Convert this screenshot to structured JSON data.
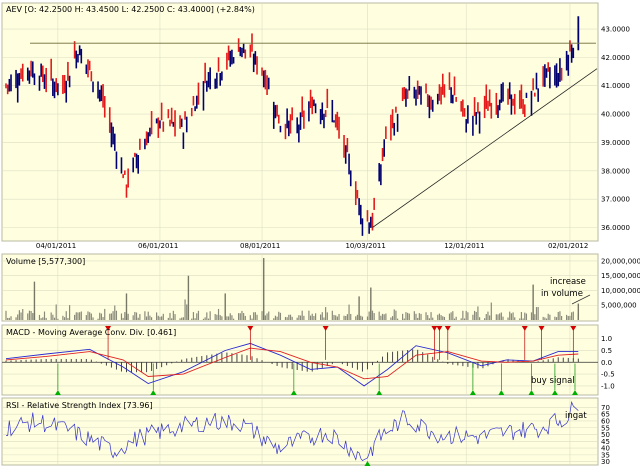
{
  "chart_data": [
    {
      "type": "candlestick",
      "title": "AEV [O: 42.2500  H: 43.4500  L: 42.2500  C: 43.4000]  (+2.84%)",
      "x_tick_labels": [
        "04/01/2011",
        "06/01/2011",
        "08/01/2011",
        "10/03/2011",
        "12/01/2011",
        "02/01/2012"
      ],
      "y_tick_labels": [
        "36.0000",
        "37.0000",
        "38.0000",
        "39.0000",
        "40.0000",
        "41.0000",
        "42.0000",
        "43.0000"
      ],
      "ylim": [
        35.7,
        43.6
      ],
      "resistance_level": 42.5,
      "trendline": {
        "start": {
          "date": "2011-10-06",
          "price": 36.0
        },
        "end": {
          "date": "2012-02-06",
          "price": 41.6
        }
      },
      "last_bar": {
        "open": 42.25,
        "high": 43.45,
        "low": 42.25,
        "close": 43.4
      },
      "series": [
        {
          "date": "2011-03-01",
          "close": 41.0
        },
        {
          "date": "2011-03-15",
          "close": 41.6
        },
        {
          "date": "2011-04-04",
          "close": 40.9
        },
        {
          "date": "2011-04-13",
          "close": 42.3
        },
        {
          "date": "2011-04-25",
          "close": 41.0
        },
        {
          "date": "2011-05-05",
          "close": 39.0
        },
        {
          "date": "2011-05-12",
          "close": 37.5
        },
        {
          "date": "2011-05-20",
          "close": 38.8
        },
        {
          "date": "2011-06-01",
          "close": 39.8
        },
        {
          "date": "2011-06-15",
          "close": 39.5
        },
        {
          "date": "2011-06-28",
          "close": 41.2
        },
        {
          "date": "2011-07-10",
          "close": 41.8
        },
        {
          "date": "2011-07-20",
          "close": 42.4
        },
        {
          "date": "2011-08-01",
          "close": 41.6
        },
        {
          "date": "2011-08-12",
          "close": 39.7
        },
        {
          "date": "2011-08-22",
          "close": 39.5
        },
        {
          "date": "2011-09-01",
          "close": 40.4
        },
        {
          "date": "2011-09-12",
          "close": 40.1
        },
        {
          "date": "2011-09-22",
          "close": 38.2
        },
        {
          "date": "2011-09-30",
          "close": 36.4
        },
        {
          "date": "2011-10-06",
          "close": 36.2
        },
        {
          "date": "2011-10-14",
          "close": 39.2
        },
        {
          "date": "2011-10-28",
          "close": 40.8
        },
        {
          "date": "2011-11-10",
          "close": 40.5
        },
        {
          "date": "2011-11-22",
          "close": 40.9
        },
        {
          "date": "2011-12-01",
          "close": 39.8
        },
        {
          "date": "2011-12-12",
          "close": 40.2
        },
        {
          "date": "2011-12-22",
          "close": 40.6
        },
        {
          "date": "2012-01-05",
          "close": 40.3
        },
        {
          "date": "2012-01-16",
          "close": 41.3
        },
        {
          "date": "2012-01-26",
          "close": 41.4
        },
        {
          "date": "2012-02-02",
          "close": 42.3
        },
        {
          "date": "2012-02-06",
          "close": 43.4
        }
      ]
    },
    {
      "type": "bar",
      "title": "Volume [5,577,300]",
      "y_tick_labels": [
        "5,000,000",
        "10,000,000",
        "15,000,000",
        "20,000,000"
      ],
      "ylim": [
        0,
        21000000
      ],
      "annotation": "increase\nin volume",
      "spikes": [
        {
          "date": "2011-03-18",
          "value": 13000000
        },
        {
          "date": "2011-05-12",
          "value": 9000000
        },
        {
          "date": "2011-06-18",
          "value": 15000000
        },
        {
          "date": "2011-08-02",
          "value": 21000000
        },
        {
          "date": "2011-07-10",
          "value": 9000000
        },
        {
          "date": "2011-09-28",
          "value": 8000000
        },
        {
          "date": "2011-10-05",
          "value": 11000000
        },
        {
          "date": "2012-01-10",
          "value": 12000000
        },
        {
          "date": "2012-02-06",
          "value": 5577300
        }
      ]
    },
    {
      "type": "line",
      "title": "MACD - Moving Average Conv. Div. [0.461]",
      "y_tick_labels": [
        "-1.0",
        "-0.5",
        "0.0",
        "0.5",
        "1.0"
      ],
      "ylim": [
        -1.3,
        1.45
      ],
      "annotation": "buy signal",
      "series": [
        {
          "name": "MACD",
          "color": "#2b2bd0",
          "values": [
            {
              "date": "2011-03-01",
              "value": 0.15
            },
            {
              "date": "2011-03-25",
              "value": 0.35
            },
            {
              "date": "2011-04-20",
              "value": 0.55
            },
            {
              "date": "2011-05-10",
              "value": -0.2
            },
            {
              "date": "2011-05-25",
              "value": -0.9
            },
            {
              "date": "2011-06-15",
              "value": -0.4
            },
            {
              "date": "2011-07-10",
              "value": 0.5
            },
            {
              "date": "2011-07-25",
              "value": 0.8
            },
            {
              "date": "2011-08-12",
              "value": 0.3
            },
            {
              "date": "2011-08-30",
              "value": -0.3
            },
            {
              "date": "2011-09-15",
              "value": -0.2
            },
            {
              "date": "2011-10-01",
              "value": -1.0
            },
            {
              "date": "2011-10-15",
              "value": -0.3
            },
            {
              "date": "2011-11-01",
              "value": 0.7
            },
            {
              "date": "2011-11-20",
              "value": 0.4
            },
            {
              "date": "2011-12-10",
              "value": -0.15
            },
            {
              "date": "2011-12-25",
              "value": 0.1
            },
            {
              "date": "2012-01-10",
              "value": 0.05
            },
            {
              "date": "2012-01-25",
              "value": 0.45
            },
            {
              "date": "2012-02-06",
              "value": 0.461
            }
          ]
        },
        {
          "name": "Signal",
          "color": "#e02020",
          "values": [
            {
              "date": "2011-03-01",
              "value": 0.1
            },
            {
              "date": "2011-03-25",
              "value": 0.25
            },
            {
              "date": "2011-04-20",
              "value": 0.45
            },
            {
              "date": "2011-05-10",
              "value": 0.1
            },
            {
              "date": "2011-05-25",
              "value": -0.6
            },
            {
              "date": "2011-06-15",
              "value": -0.5
            },
            {
              "date": "2011-07-10",
              "value": 0.2
            },
            {
              "date": "2011-07-25",
              "value": 0.6
            },
            {
              "date": "2011-08-12",
              "value": 0.45
            },
            {
              "date": "2011-08-30",
              "value": 0.0
            },
            {
              "date": "2011-09-15",
              "value": -0.2
            },
            {
              "date": "2011-10-01",
              "value": -0.7
            },
            {
              "date": "2011-10-15",
              "value": -0.6
            },
            {
              "date": "2011-11-01",
              "value": 0.3
            },
            {
              "date": "2011-11-20",
              "value": 0.45
            },
            {
              "date": "2011-12-10",
              "value": 0.05
            },
            {
              "date": "2011-12-25",
              "value": 0.0
            },
            {
              "date": "2012-01-10",
              "value": 0.05
            },
            {
              "date": "2012-01-25",
              "value": 0.3
            },
            {
              "date": "2012-02-06",
              "value": 0.35
            }
          ]
        }
      ],
      "sell_signals": [
        "2011-05-01",
        "2011-07-25",
        "2011-09-08",
        "2011-11-12",
        "2011-11-15",
        "2011-11-20",
        "2012-01-05",
        "2012-01-15",
        "2012-02-03"
      ],
      "buy_signals": [
        "2011-04-01",
        "2011-05-28",
        "2011-08-20",
        "2011-10-10",
        "2011-12-05",
        "2011-12-22",
        "2012-01-09",
        "2012-01-23",
        "2012-02-04"
      ]
    },
    {
      "type": "line",
      "title": "RSI - Relative Strength Index [73.96]",
      "y_tick_labels": [
        "30",
        "35",
        "40",
        "45",
        "50",
        "55",
        "60",
        "65",
        "70"
      ],
      "ylim": [
        29,
        74
      ],
      "annotation": "ingat",
      "series": [
        {
          "name": "RSI",
          "color": "#3333cc",
          "values": [
            {
              "date": "2011-03-01",
              "value": 55
            },
            {
              "date": "2011-03-20",
              "value": 60
            },
            {
              "date": "2011-04-10",
              "value": 52
            },
            {
              "date": "2011-05-05",
              "value": 38
            },
            {
              "date": "2011-05-20",
              "value": 48
            },
            {
              "date": "2011-06-10",
              "value": 55
            },
            {
              "date": "2011-07-01",
              "value": 60
            },
            {
              "date": "2011-07-20",
              "value": 58
            },
            {
              "date": "2011-08-10",
              "value": 40
            },
            {
              "date": "2011-08-25",
              "value": 46
            },
            {
              "date": "2011-09-10",
              "value": 52
            },
            {
              "date": "2011-10-01",
              "value": 32
            },
            {
              "date": "2011-10-12",
              "value": 50
            },
            {
              "date": "2011-10-25",
              "value": 62
            },
            {
              "date": "2011-11-15",
              "value": 50
            },
            {
              "date": "2011-12-10",
              "value": 48
            },
            {
              "date": "2011-12-25",
              "value": 52
            },
            {
              "date": "2012-01-15",
              "value": 55
            },
            {
              "date": "2012-01-30",
              "value": 63
            },
            {
              "date": "2012-02-06",
              "value": 73.96
            }
          ]
        }
      ],
      "oversold_marker": "2011-10-03"
    }
  ]
}
